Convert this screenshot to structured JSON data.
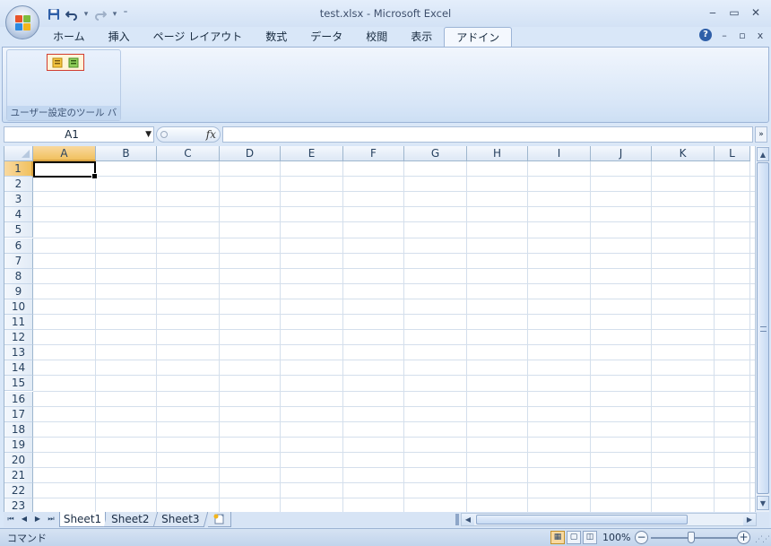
{
  "window": {
    "title": "test.xlsx - Microsoft Excel",
    "controls": {
      "minimize": "‒",
      "maximize": "▭",
      "close": "✕"
    }
  },
  "quick_access": {
    "save_icon": "save-icon",
    "undo_icon": "undo-icon",
    "redo_icon": "redo-icon",
    "customize_icon": "customize-icon"
  },
  "ribbon": {
    "tabs": [
      {
        "label": "ホーム"
      },
      {
        "label": "挿入"
      },
      {
        "label": "ページ レイアウト"
      },
      {
        "label": "数式"
      },
      {
        "label": "データ"
      },
      {
        "label": "校閲"
      },
      {
        "label": "表示"
      },
      {
        "label": "アドイン",
        "active": true
      }
    ],
    "group_label": "ユーザー設定のツール バー",
    "help": "?",
    "mdi": {
      "minimize": "–",
      "restore": "▫",
      "close": "x"
    }
  },
  "formula_bar": {
    "name_box": "A1",
    "fx_label": "fx",
    "formula": "",
    "expand": "»"
  },
  "grid": {
    "columns": [
      "A",
      "B",
      "C",
      "D",
      "E",
      "F",
      "G",
      "H",
      "I",
      "J",
      "K",
      "L"
    ],
    "rows": [
      "1",
      "2",
      "3",
      "4",
      "5",
      "6",
      "7",
      "8",
      "9",
      "10",
      "11",
      "12",
      "13",
      "14",
      "15",
      "16",
      "17",
      "18",
      "19",
      "20",
      "21",
      "22",
      "23"
    ],
    "active_cell": "A1"
  },
  "sheets": {
    "tabs": [
      "Sheet1",
      "Sheet2",
      "Sheet3"
    ],
    "active": "Sheet1",
    "nav": [
      "⏮",
      "◀",
      "▶",
      "⏭"
    ]
  },
  "status": {
    "mode": "コマンド",
    "zoom": "100%"
  },
  "colors": {
    "accent": "#f1c15f",
    "frame": "#d9e7f8",
    "selected_border": "#000000"
  }
}
